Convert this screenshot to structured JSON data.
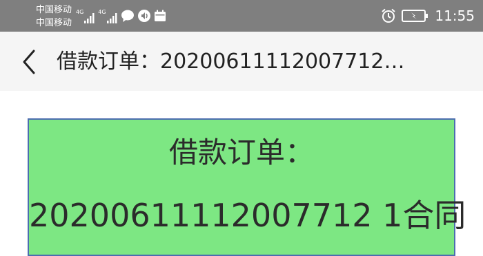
{
  "status_bar": {
    "carrier_1": "中国移动",
    "carrier_2": "中国移动",
    "network_1": "4G",
    "network_2": "4G",
    "time": "11:55",
    "icons": [
      "signal-icon",
      "signal-icon",
      "message-icon",
      "sound-icon",
      "calendar-icon",
      "alarm-icon",
      "battery-charging-icon"
    ]
  },
  "nav": {
    "title": "借款订单：20200611112007712…",
    "back_icon": "chevron-left-icon"
  },
  "card": {
    "title": "借款订单：",
    "number": "20200611112007712 1合同"
  },
  "colors": {
    "status_bar_bg": "#7f7f7f",
    "nav_bg": "#f5f5f5",
    "card_bg": "#7de783",
    "card_border": "#4c6db0",
    "text": "#222222"
  }
}
